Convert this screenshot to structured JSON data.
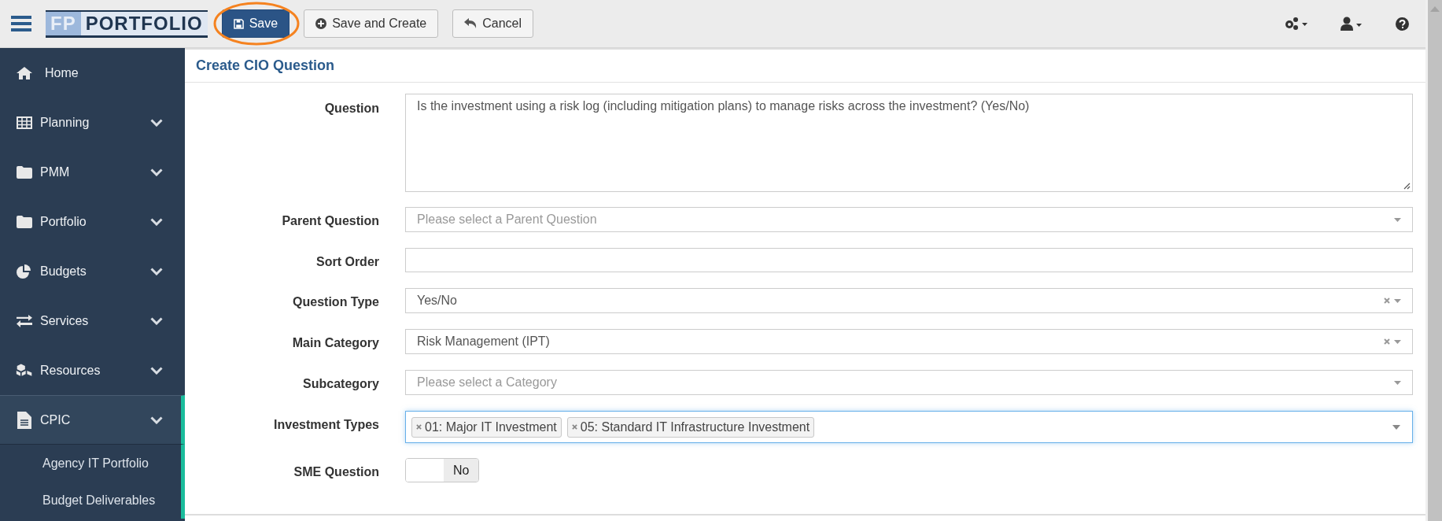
{
  "topbar": {
    "logo": {
      "prefix": "FP",
      "name": "PORTFOLIO"
    },
    "buttons": [
      {
        "kind": "primary",
        "label": "Save",
        "annotated": true
      },
      {
        "kind": "default",
        "label": "Save and Create",
        "annotated": false
      },
      {
        "kind": "default",
        "label": "Cancel",
        "annotated": false
      }
    ]
  },
  "sidebar": {
    "items": [
      {
        "label": "Home",
        "kind": "link",
        "selected": false
      },
      {
        "label": "Planning",
        "kind": "group",
        "selected": false
      },
      {
        "label": "PMM",
        "kind": "group",
        "selected": false
      },
      {
        "label": "Portfolio",
        "kind": "group",
        "selected": false
      },
      {
        "label": "Budgets",
        "kind": "group",
        "selected": false
      },
      {
        "label": "Services",
        "kind": "group",
        "selected": false
      },
      {
        "label": "Resources",
        "kind": "group",
        "selected": false
      },
      {
        "label": "CPIC",
        "kind": "group",
        "selected": true,
        "expanded": true,
        "children": [
          {
            "label": "Agency IT Portfolio",
            "selected": false
          },
          {
            "label": "Budget Deliverables",
            "selected": false
          }
        ]
      }
    ]
  },
  "form": {
    "title": "Create CIO Question",
    "fields": [
      {
        "label": "Question",
        "kind": "textarea",
        "value": "Is the investment using a risk log (including mitigation plans) to manage risks across the investment? (Yes/No)"
      },
      {
        "label": "Parent Question",
        "kind": "select",
        "placeholder": "Please select a Parent Question",
        "clearable": false
      },
      {
        "label": "Sort Order",
        "kind": "text"
      },
      {
        "label": "Question Type",
        "kind": "select",
        "value": "Yes/No",
        "clearable": true
      },
      {
        "label": "Main Category",
        "kind": "select",
        "value": "Risk Management (IPT)",
        "clearable": true
      },
      {
        "label": "Subcategory",
        "kind": "select",
        "placeholder": "Please select a Category",
        "clearable": false
      },
      {
        "label": "Investment Types",
        "kind": "multiselect",
        "focused": true,
        "tags": [
          "01: Major IT Investment",
          "05: Standard IT Infrastructure Investment"
        ]
      },
      {
        "label": "SME Question",
        "kind": "toggle",
        "on": false,
        "text": "No"
      }
    ]
  }
}
